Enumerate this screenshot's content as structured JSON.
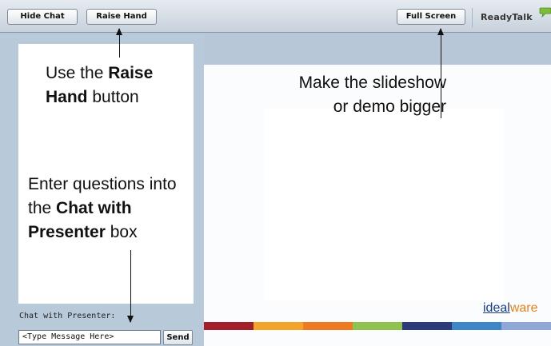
{
  "toolbar": {
    "hide_chat": "Hide Chat",
    "raise_hand": "Raise Hand",
    "full_screen": "Full Screen",
    "logo": "ReadyTalk"
  },
  "annotations": {
    "raise_hand_1": "Use the ",
    "raise_hand_2": "Raise Hand",
    "raise_hand_3": " button",
    "full_screen_1": "Make the slideshow",
    "full_screen_2": "or demo bigger",
    "chat_1": "Enter questions into the ",
    "chat_2": "Chat with Presenter",
    "chat_3": " box"
  },
  "chat": {
    "label": "Chat with Presenter:",
    "input_value": "<Type Message Here>",
    "send": "Send"
  },
  "slide": {
    "brand_part1": "ideal",
    "brand_part2": "ware",
    "bar_colors": [
      "#a3202a",
      "#f4a32b",
      "#ee7a22",
      "#8fc24f",
      "#2c3b7a",
      "#3f86c9",
      "#8fa8d8"
    ]
  },
  "colors": {
    "panel": "#b8c9da",
    "toolbar": "#d4dbe4"
  }
}
